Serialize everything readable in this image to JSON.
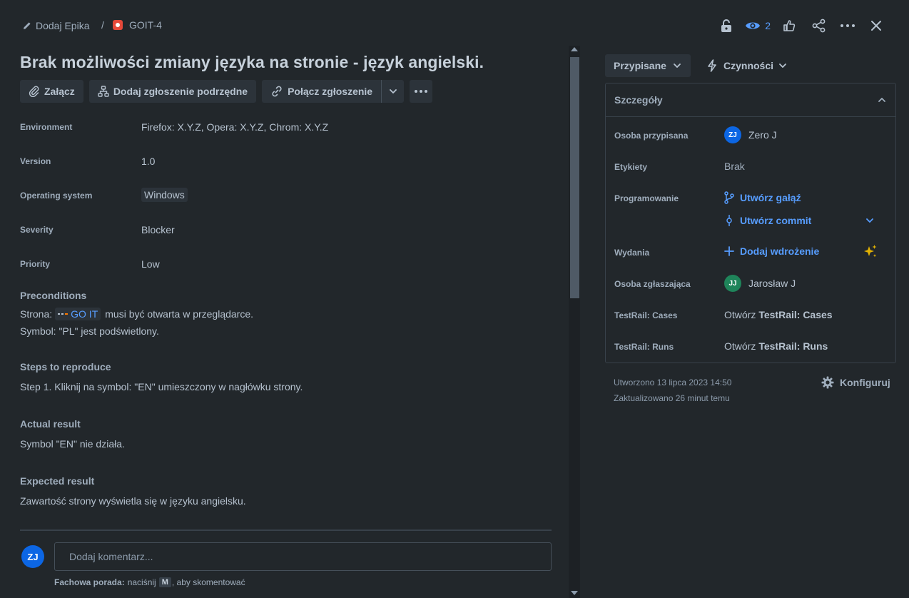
{
  "breadcrumb": {
    "epic_label": "Dodaj Epika",
    "separator": "/",
    "issue_key": "GOIT-4"
  },
  "header": {
    "watch_count": "2"
  },
  "issue": {
    "title": "Brak możliwości zmiany języka na stronie - język angielski."
  },
  "toolbar": {
    "attach": "Załącz",
    "add_child": "Dodaj zgłoszenie podrzędne",
    "link_issue": "Połącz zgłoszenie"
  },
  "fields": [
    {
      "label": "Environment",
      "value": "Firefox: X.Y.Z, Opera: X.Y.Z, Chrom: X.Y.Z"
    },
    {
      "label": "Version",
      "value": "1.0"
    },
    {
      "label": "Operating system",
      "value": "Windows"
    },
    {
      "label": "Severity",
      "value": "Blocker"
    },
    {
      "label": "Priority",
      "value": "Low"
    }
  ],
  "sections": {
    "preconditions": {
      "heading": "Preconditions",
      "line1_prefix": "Strona:",
      "line1_link": "GO IT",
      "line1_suffix": "musi być otwarta w przeglądarce.",
      "line2": "Symbol: \"PL\" jest podświetlony."
    },
    "steps": {
      "heading": "Steps to reproduce",
      "text": "Step 1. Kliknij na symbol: \"EN\" umieszczony w nagłówku strony."
    },
    "actual": {
      "heading": "Actual result",
      "text": "Symbol \"EN\" nie działa."
    },
    "expected": {
      "heading": "Expected result",
      "text": "Zawartość strony wyświetla się w języku angielsku."
    }
  },
  "comment": {
    "avatar_initials": "ZJ",
    "placeholder": "Dodaj komentarz...",
    "tip_bold": "Fachowa porada:",
    "tip_pre": "naciśnij",
    "tip_key": "M",
    "tip_post": ", aby skomentować"
  },
  "side": {
    "status": "Przypisane",
    "actions": "Czynności",
    "details_title": "Szczegóły",
    "assignee_label": "Osoba przypisana",
    "assignee_initials": "ZJ",
    "assignee_name": "Zero J",
    "labels_label": "Etykiety",
    "labels_value": "Brak",
    "dev_label": "Programowanie",
    "create_branch": "Utwórz gałąź",
    "create_commit": "Utwórz commit",
    "releases_label": "Wydania",
    "add_deployment": "Dodaj wdrożenie",
    "reporter_label": "Osoba zgłaszająca",
    "reporter_initials": "JJ",
    "reporter_name": "Jarosław J",
    "tr_cases_label": "TestRail: Cases",
    "tr_cases_pre": "Otwórz",
    "tr_cases_bold": "TestRail: Cases",
    "tr_runs_label": "TestRail: Runs",
    "tr_runs_pre": "Otwórz",
    "tr_runs_bold": "TestRail: Runs",
    "created": "Utworzono 13 lipca 2023 14:50",
    "updated": "Zaktualizowano 26 minut temu",
    "configure": "Konfiguruj"
  },
  "colors": {
    "background": "#22272b",
    "link": "#579dff",
    "assignee_avatar": "#0c66e4",
    "reporter_avatar": "#1f845a",
    "bug_icon": "#e5493a",
    "sparkle": "#e2b203"
  }
}
